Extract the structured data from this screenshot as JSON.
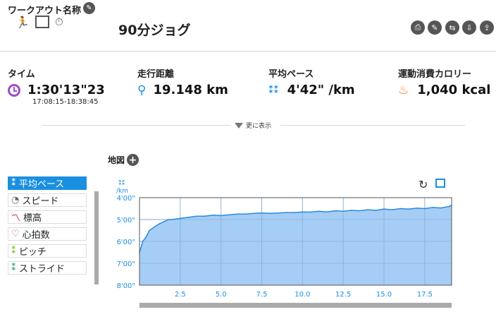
{
  "header": {
    "workout_name_label": "ワークアウト名称",
    "title": "90分ジョグ"
  },
  "stats": [
    {
      "label": "タイム",
      "value": "1:30'13\"23",
      "sub": "17:08:15-18:38:45",
      "icon": "clock-icon",
      "color": "#9b4fc8"
    },
    {
      "label": "走行距離",
      "value": "19.148 km",
      "icon": "route-pin-icon",
      "color": "#1a8fe0"
    },
    {
      "label": "平均ペース",
      "value": "4'42\" /km",
      "icon": "footprints-icon",
      "color": "#1a8fe0"
    },
    {
      "label": "運動消費カロリー",
      "value": "1,040 kcal",
      "icon": "flame-icon",
      "color": "#f07a23"
    }
  ],
  "more_label": "更に表示",
  "map_label": "地図",
  "sidebar": {
    "items": [
      {
        "label": "平均ペース",
        "icon": "footprints-icon",
        "active": true
      },
      {
        "label": "スピード",
        "icon": "speedometer-icon",
        "active": false
      },
      {
        "label": "標高",
        "icon": "elevation-icon",
        "active": false
      },
      {
        "label": "心拍数",
        "icon": "heart-icon",
        "active": false
      },
      {
        "label": "ピッチ",
        "icon": "pitch-icon",
        "active": false
      },
      {
        "label": "ストライド",
        "icon": "stride-icon",
        "active": false
      }
    ]
  },
  "chart_data": {
    "type": "area",
    "ylabel": "/km",
    "y_ticks": [
      "4'00\"",
      "5'00\"",
      "6'00\"",
      "7'00\"",
      "8'00\""
    ],
    "x_ticks": [
      "2.5",
      "5.0",
      "7.5",
      "10.0",
      "12.5",
      "15.0",
      "17.5"
    ],
    "xlim": [
      0,
      19.148
    ],
    "ylim_min_per_km": [
      4,
      8
    ],
    "y_axis_inverted": true,
    "series": [
      {
        "x": [
          0,
          0.2,
          0.4,
          0.6,
          0.8,
          1.0,
          1.2,
          1.5,
          1.8,
          2.0,
          2.5,
          3.0,
          3.5,
          4.0,
          4.5,
          5.0,
          5.5,
          6.0,
          6.5,
          7.0,
          7.5,
          8.0,
          8.5,
          9.0,
          9.5,
          10.0,
          10.5,
          11.0,
          11.5,
          12.0,
          12.5,
          13.0,
          13.5,
          14.0,
          14.5,
          15.0,
          15.5,
          16.0,
          16.5,
          17.0,
          17.5,
          18.0,
          18.5,
          19.0,
          19.148
        ],
        "values": [
          6.5,
          6.0,
          5.8,
          5.5,
          5.4,
          5.3,
          5.2,
          5.1,
          5.0,
          5.0,
          4.95,
          4.9,
          4.85,
          4.85,
          4.8,
          4.82,
          4.78,
          4.75,
          4.75,
          4.72,
          4.7,
          4.72,
          4.7,
          4.68,
          4.68,
          4.65,
          4.66,
          4.62,
          4.65,
          4.6,
          4.62,
          4.58,
          4.6,
          4.55,
          4.58,
          4.52,
          4.55,
          4.5,
          4.52,
          4.48,
          4.5,
          4.45,
          4.47,
          4.4,
          4.35
        ]
      }
    ],
    "fill_color": "#a6cdf5",
    "line_color": "#2a8ae0",
    "grid": true
  }
}
